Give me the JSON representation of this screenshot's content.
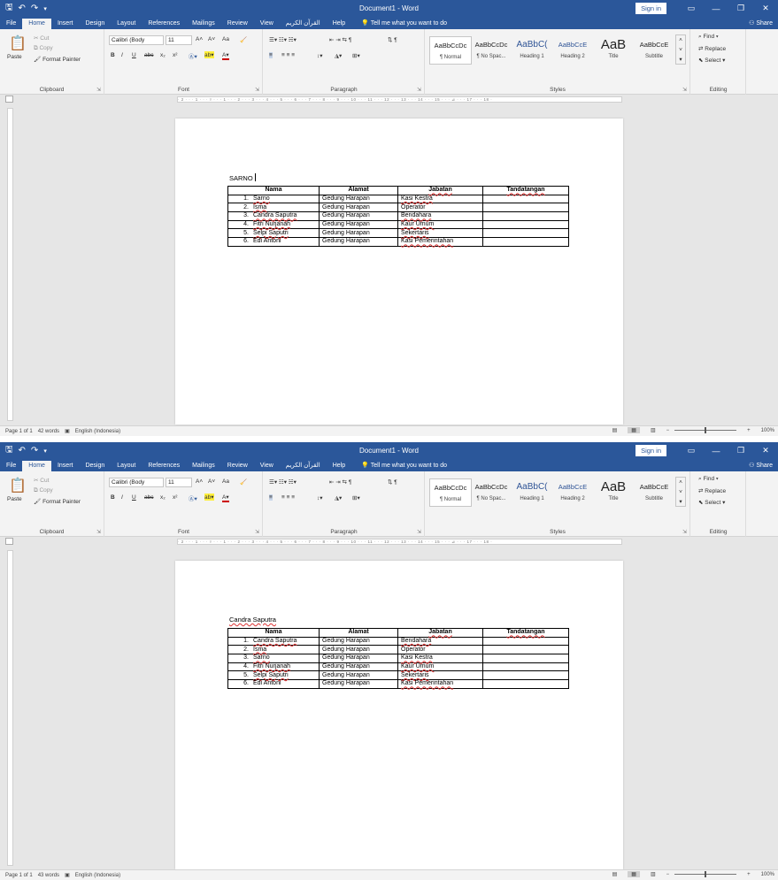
{
  "app": {
    "title": "Document1 - Word",
    "sign_in": "Sign in",
    "share": "Share",
    "tabs": [
      "File",
      "Home",
      "Insert",
      "Design",
      "Layout",
      "References",
      "Mailings",
      "Review",
      "View",
      "القرآن الكريم",
      "Help"
    ],
    "tell_me": "Tell me what you want to do",
    "icons": {
      "save": "save-icon",
      "undo": "undo-icon",
      "redo": "redo-icon",
      "ribbon_display": "ribbon-display-icon",
      "minimize": "minimize-icon",
      "restore": "restore-icon",
      "close": "close-icon",
      "search": "lightbulb-icon"
    }
  },
  "ribbon": {
    "clipboard": {
      "label": "Clipboard",
      "paste": "Paste",
      "cut": "Cut",
      "copy": "Copy",
      "format_painter": "Format Painter"
    },
    "font": {
      "label": "Font",
      "font_name": "Calibri (Body",
      "font_size": "11",
      "bold": "B",
      "italic": "I",
      "underline": "U",
      "strike": "abc",
      "subscript": "x₂",
      "superscript": "x²",
      "grow": "A˄",
      "shrink": "A˅",
      "case": "Aa"
    },
    "paragraph": {
      "label": "Paragraph"
    },
    "styles": {
      "label": "Styles"
    },
    "editing": {
      "label": "Editing",
      "find": "Find",
      "replace": "Replace",
      "select": "Select"
    }
  },
  "windows": [
    {
      "styles": [
        {
          "sample": "AaBbCcDc",
          "name": "¶ Normal"
        },
        {
          "sample": "AaBbCcDc",
          "name": "¶ No Spac..."
        },
        {
          "sample": "AaBbC(",
          "name": "Heading 1"
        },
        {
          "sample": "AaBbCcE",
          "name": "Heading 2"
        },
        {
          "sample": "AaB",
          "name": "Title"
        },
        {
          "sample": "AaBbCcE",
          "name": "Subtitle"
        }
      ],
      "doc_text": "SARNO",
      "table": {
        "headers": [
          "Nama",
          "Alamat",
          "Jabatan",
          "Tandatangan"
        ],
        "rows": [
          {
            "num": "1.",
            "nama": "Sarno",
            "alamat": "Gedung Harapan",
            "jabatan": "Kasi Kestra"
          },
          {
            "num": "2.",
            "nama": "Isma",
            "alamat": "Gedung Harapan",
            "jabatan": "Operator"
          },
          {
            "num": "3.",
            "nama": "Candra Saputra",
            "alamat": "Gedung Harapan",
            "jabatan": "Bendahara"
          },
          {
            "num": "4.",
            "nama": "Fitri Nurjanah",
            "alamat": "Gedung Harapan",
            "jabatan": "Kaur Umum"
          },
          {
            "num": "5.",
            "nama": "Selpi Saputri",
            "alamat": "Gedung Harapan",
            "jabatan": "Sekertaris"
          },
          {
            "num": "6.",
            "nama": "Edi Antoni",
            "alamat": "Gedung Harapan",
            "jabatan": "Kasi Pemerintahan"
          }
        ]
      },
      "status": {
        "page": "Page 1 of 1",
        "words": "42 words",
        "language": "English (Indonesia)",
        "zoom": "100%"
      }
    },
    {
      "styles": [
        {
          "sample": "AaBbCcDc",
          "name": "¶ Normal"
        },
        {
          "sample": "AaBbCcDc",
          "name": "¶ No Spac..."
        },
        {
          "sample": "AaBbC(",
          "name": "Heading 1"
        },
        {
          "sample": "AaBbCcE",
          "name": "Heading 2"
        },
        {
          "sample": "AaB",
          "name": "Title"
        },
        {
          "sample": "AaBbCcE",
          "name": "Subtitle"
        }
      ],
      "doc_text": "Candra Saputra",
      "table": {
        "headers": [
          "Nama",
          "Alamat",
          "Jabatan",
          "Tandatangan"
        ],
        "rows": [
          {
            "num": "1.",
            "nama": "Candra Saputra",
            "alamat": "Gedung Harapan",
            "jabatan": "Bendahara"
          },
          {
            "num": "2.",
            "nama": "Isma",
            "alamat": "Gedung Harapan",
            "jabatan": "Operator"
          },
          {
            "num": "3.",
            "nama": "Sarno",
            "alamat": "Gedung Harapan",
            "jabatan": "Kasi Kestra"
          },
          {
            "num": "4.",
            "nama": "Fitri Nurjanah",
            "alamat": "Gedung Harapan",
            "jabatan": "Kaur Umum"
          },
          {
            "num": "5.",
            "nama": "Selpi Saputri",
            "alamat": "Gedung Harapan",
            "jabatan": "Sekertaris"
          },
          {
            "num": "6.",
            "nama": "Edi Antoni",
            "alamat": "Gedung Harapan",
            "jabatan": "Kasi Pemerintahan"
          }
        ]
      },
      "status": {
        "page": "Page 1 of 1",
        "words": "43 words",
        "language": "English (Indonesia)",
        "zoom": "100%"
      }
    }
  ]
}
